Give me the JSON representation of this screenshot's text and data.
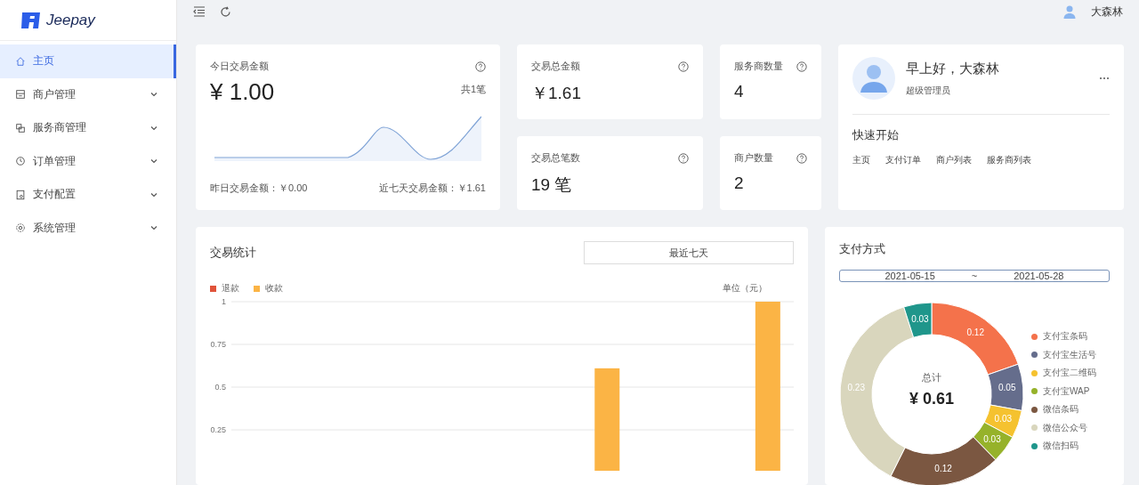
{
  "brand": {
    "name": "Jeepay"
  },
  "sidebar": {
    "items": [
      {
        "label": "主页",
        "selected": true,
        "expandable": false
      },
      {
        "label": "商户管理",
        "selected": false,
        "expandable": true
      },
      {
        "label": "服务商管理",
        "selected": false,
        "expandable": true
      },
      {
        "label": "订单管理",
        "selected": false,
        "expandable": true
      },
      {
        "label": "支付配置",
        "selected": false,
        "expandable": true
      },
      {
        "label": "系统管理",
        "selected": false,
        "expandable": true
      }
    ]
  },
  "header": {
    "user": "大森林"
  },
  "today": {
    "title": "今日交易金额",
    "amount": "¥ 1.00",
    "count": "共1笔",
    "yesterday": "昨日交易金额：￥0.00",
    "week": "近七天交易金额：￥1.61"
  },
  "stats": [
    {
      "title": "交易总金额",
      "value": "￥1.61"
    },
    {
      "title": "服务商数量",
      "value": "4"
    },
    {
      "title": "交易总笔数",
      "value": "19 笔"
    },
    {
      "title": "商户数量",
      "value": "2"
    }
  ],
  "welcome": {
    "greeting": "早上好，大森林",
    "role": "超级管理员",
    "quick_title": "快速开始",
    "links": [
      "主页",
      "支付订单",
      "商户列表",
      "服务商列表"
    ]
  },
  "trade_stats": {
    "title": "交易统计",
    "range": "最近七天",
    "unit": "单位（元）",
    "chart_data": {
      "type": "bar",
      "grid": true,
      "yticks": [
        0.25,
        0.5,
        0.75,
        1
      ],
      "ylim": [
        0,
        1
      ],
      "series": [
        {
          "name": "退款",
          "color": "#e0533a",
          "values": [
            0,
            0,
            0,
            0,
            0,
            0,
            0
          ]
        },
        {
          "name": "收款",
          "color": "#fbb445",
          "values": [
            0,
            0,
            0,
            0,
            0.61,
            0,
            1
          ]
        }
      ]
    }
  },
  "pay_methods": {
    "title": "支付方式",
    "date_from": "2021-05-15",
    "separator": "~",
    "date_to": "2021-05-28",
    "total_label": "总计",
    "total": "¥ 0.61",
    "chart_data": {
      "type": "donut",
      "data_labels": true,
      "categories": [
        "支付宝条码",
        "支付宝生活号",
        "支付宝二维码",
        "支付宝WAP",
        "微信条码",
        "微信公众号",
        "微信扫码"
      ],
      "values": [
        0.12,
        0.05,
        0.03,
        0.03,
        0.12,
        0.23,
        0.03
      ],
      "colors": [
        "#f4724b",
        "#656d8c",
        "#f5c22f",
        "#96b22a",
        "#7b5741",
        "#d9d6bd",
        "#1f968b"
      ]
    }
  }
}
